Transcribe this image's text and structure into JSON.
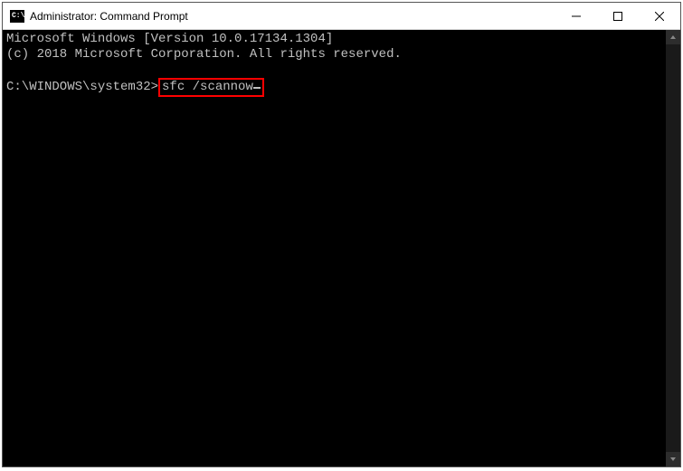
{
  "titlebar": {
    "icon_text": "C:\\",
    "title": "Administrator: Command Prompt"
  },
  "terminal": {
    "line1": "Microsoft Windows [Version 10.0.17134.1304]",
    "line2": "(c) 2018 Microsoft Corporation. All rights reserved.",
    "prompt": "C:\\WINDOWS\\system32>",
    "command": "sfc /scannow"
  }
}
